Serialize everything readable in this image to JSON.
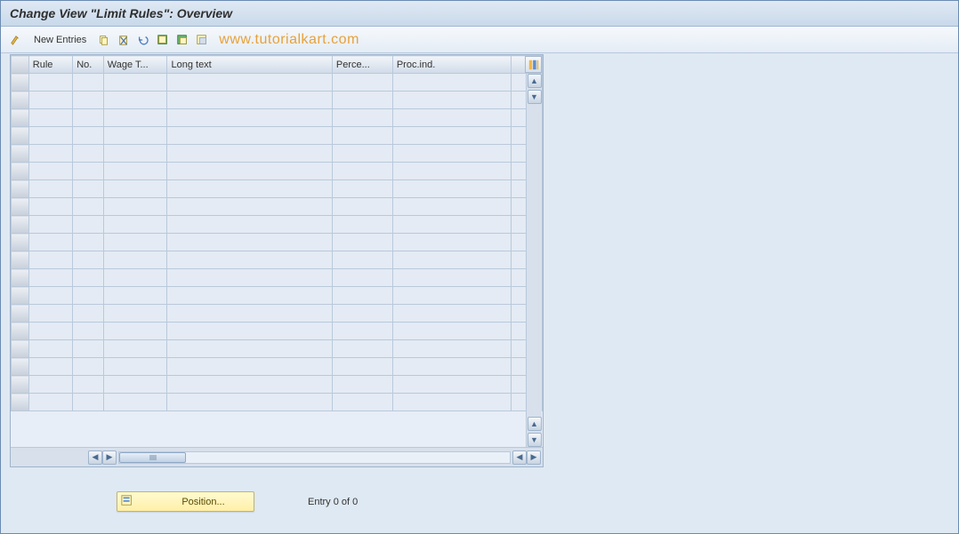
{
  "title": "Change View \"Limit Rules\": Overview",
  "toolbar": {
    "new_entries": "New Entries"
  },
  "watermark": "www.tutorialkart.com",
  "table": {
    "columns": [
      "Rule",
      "No.",
      "Wage T...",
      "Long text",
      "Perce...",
      "Proc.ind."
    ],
    "rows": 19
  },
  "footer": {
    "position_label": "Position...",
    "entry_text": "Entry 0 of 0"
  }
}
